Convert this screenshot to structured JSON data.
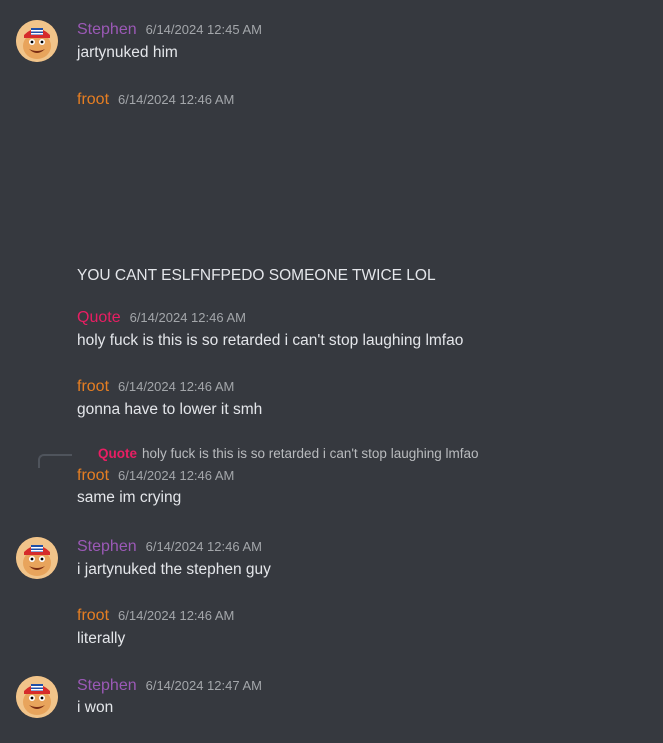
{
  "messages": [
    {
      "author": "Stephen",
      "time": "6/14/2024 12:45 AM",
      "text": "jartynuked him"
    },
    {
      "author": "froot",
      "time": "6/14/2024 12:46 AM",
      "text": "YOU CANT ESLFNFPEDO SOMEONE TWICE LOL"
    },
    {
      "author": "Quote",
      "time": "6/14/2024 12:46 AM",
      "text": "holy fuck is this is so retarded i can't stop laughing lmfao"
    },
    {
      "author": "froot",
      "time": "6/14/2024 12:46 AM",
      "text": "gonna have to lower it smh"
    },
    {
      "author": "froot",
      "time": "6/14/2024 12:46 AM",
      "text": "same im crying",
      "reply": {
        "author": "Quote",
        "text": "holy fuck is this is so retarded i can't stop laughing lmfao"
      }
    },
    {
      "author": "Stephen",
      "time": "6/14/2024 12:46 AM",
      "text": "i jartynuked the stephen guy"
    },
    {
      "author": "froot",
      "time": "6/14/2024 12:46 AM",
      "text": "literally"
    },
    {
      "author": "Stephen",
      "time": "6/14/2024 12:47 AM",
      "text": "i won"
    }
  ],
  "colors": {
    "stephen": "#9b59b6",
    "froot": "#e67e22",
    "quote": "#e91e63",
    "background": "#36393f"
  },
  "icons": {
    "avatar": "cartoon-face-with-usa-cap-icon"
  }
}
